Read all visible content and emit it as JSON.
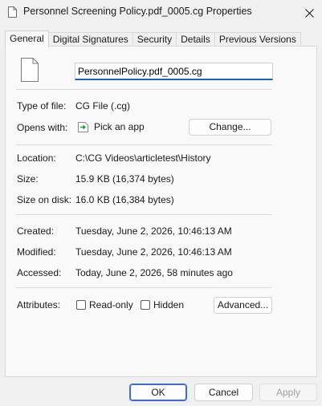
{
  "window": {
    "title": "Personnel Screening Policy.pdf_0005.cg Properties"
  },
  "tabs": [
    {
      "label": "General"
    },
    {
      "label": "Digital Signatures"
    },
    {
      "label": "Security"
    },
    {
      "label": "Details"
    },
    {
      "label": "Previous Versions"
    }
  ],
  "general": {
    "filename": "PersonnelPolicy.pdf_0005.cg",
    "type_label": "Type of file:",
    "type_value": "CG File (.cg)",
    "opens_label": "Opens with:",
    "opens_value": "Pick an app",
    "change_button": "Change...",
    "location_label": "Location:",
    "location_value": "C:\\CG Videos\\articletest\\History",
    "size_label": "Size:",
    "size_value": "15.9 KB (16,374 bytes)",
    "size_on_disk_label": "Size on disk:",
    "size_on_disk_value": "16.0 KB (16,384 bytes)",
    "created_label": "Created:",
    "created_value": "Tuesday, June 2, 2026, 10:46:13 AM",
    "modified_label": "Modified:",
    "modified_value": "Tuesday, June 2, 2026, 10:46:13 AM",
    "accessed_label": "Accessed:",
    "accessed_value": "Today, June 2, 2026, 58 minutes ago",
    "attributes_label": "Attributes:",
    "readonly_label": "Read-only",
    "hidden_label": "Hidden",
    "advanced_button": "Advanced..."
  },
  "footer": {
    "ok": "OK",
    "cancel": "Cancel",
    "apply": "Apply"
  },
  "colors": {
    "accent": "#1f5fbf",
    "panel_bg": "#f9f9f9",
    "window_bg": "#f0f0f0"
  }
}
